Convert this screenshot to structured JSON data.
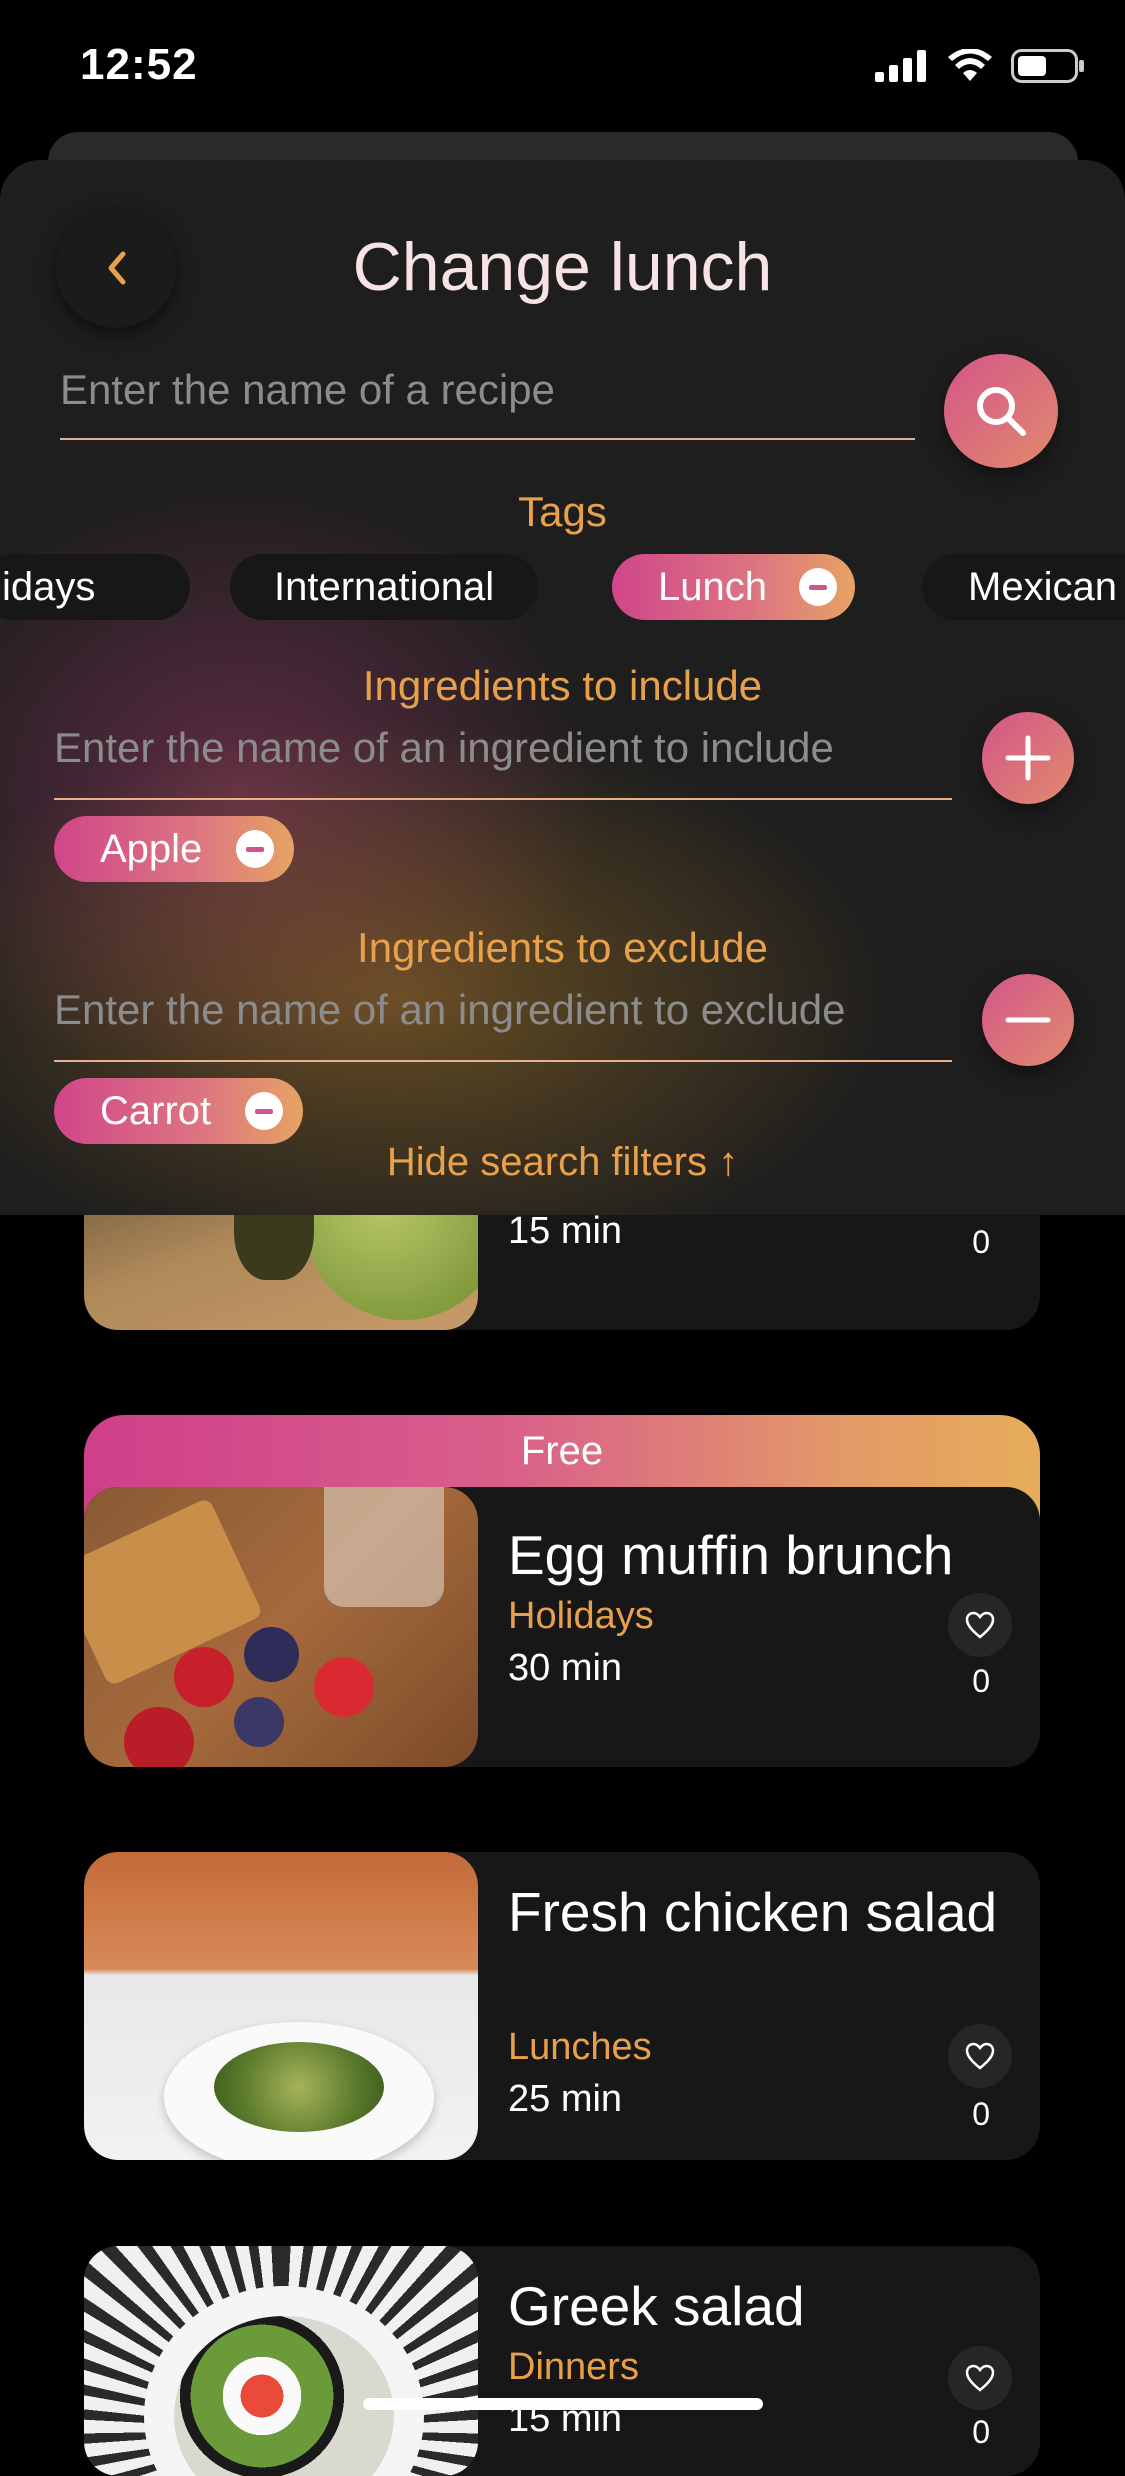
{
  "status": {
    "time": "12:52"
  },
  "panel": {
    "title": "Change lunch",
    "search_placeholder": "Enter the name of a recipe",
    "tags_label": "Tags",
    "tags": [
      {
        "label": "Holidays",
        "active": false
      },
      {
        "label": "International",
        "active": false
      },
      {
        "label": "Lunch",
        "active": true
      },
      {
        "label": "Mexican",
        "active": false
      }
    ],
    "include": {
      "label": "Ingredients to include",
      "placeholder": "Enter the name of an ingredient to include",
      "chips": [
        "Apple"
      ]
    },
    "exclude": {
      "label": "Ingredients to exclude",
      "placeholder": "Enter the name of an ingredient to exclude",
      "chips": [
        "Carrot"
      ]
    },
    "hide_filters_label": "Hide search filters ↑"
  },
  "recipes": [
    {
      "name": "",
      "category": "",
      "time": "15 min",
      "likes": "0"
    },
    {
      "badge": "Free",
      "name": "Egg muffin brunch",
      "category": "Holidays",
      "time": "30 min",
      "likes": "0"
    },
    {
      "name": "Fresh chicken salad",
      "category": "Lunches",
      "time": "25 min",
      "likes": "0"
    },
    {
      "name": "Greek salad",
      "category": "Dinners",
      "time": "15 min",
      "likes": "0"
    }
  ],
  "colors": {
    "accent_orange": "#e9a04a",
    "gradient_pink": "#d0468a",
    "gradient_gold": "#e6a363",
    "card_bg": "#171717"
  },
  "icons": {
    "back": "chevron-left-icon",
    "search": "search-icon",
    "add": "plus-icon",
    "remove": "minus-icon",
    "like": "heart-icon"
  }
}
